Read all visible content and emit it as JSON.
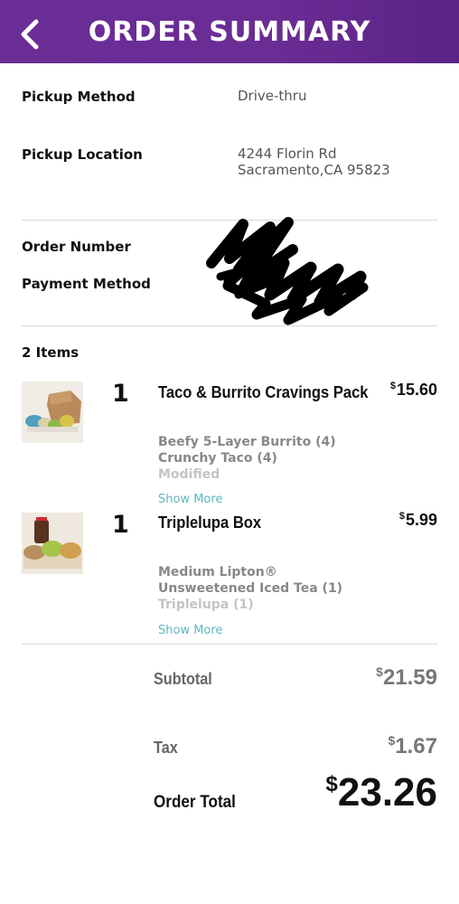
{
  "header": {
    "title": "ORDER SUMMARY",
    "back_icon": "chevron-left-icon"
  },
  "details": {
    "pickup_method_label": "Pickup Method",
    "pickup_method_value": "Drive-thru",
    "pickup_location_label": "Pickup Location",
    "pickup_location_line1": "4244 Florin Rd",
    "pickup_location_line2": "Sacramento,CA 95823",
    "order_number_label": "Order Number",
    "payment_method_label": "Payment Method"
  },
  "items_count": "2 Items",
  "items": [
    {
      "qty": "1",
      "name": "Taco & Burrito Cravings Pack",
      "price_symbol": "$",
      "price": "15.60",
      "mods": [
        "Beefy 5-Layer Burrito (4)",
        "Crunchy Taco (4)",
        "Modified"
      ],
      "show_more": "Show More"
    },
    {
      "qty": "1",
      "name": "Triplelupa Box",
      "price_symbol": "$",
      "price": "5.99",
      "mods": [
        "Medium Lipton®",
        "Unsweetened Iced Tea (1)",
        "Triplelupa (1)"
      ],
      "show_more": "Show More"
    }
  ],
  "summary": {
    "subtotal_label": "Subtotal",
    "subtotal_symbol": "$",
    "subtotal_value": "21.59",
    "tax_label": "Tax",
    "tax_symbol": "$",
    "tax_value": "1.67",
    "total_label": "Order Total",
    "total_symbol": "$",
    "total_value": "23.26"
  },
  "colors": {
    "header_purple": "#6a2c95",
    "link_teal": "#5cb6bf"
  }
}
